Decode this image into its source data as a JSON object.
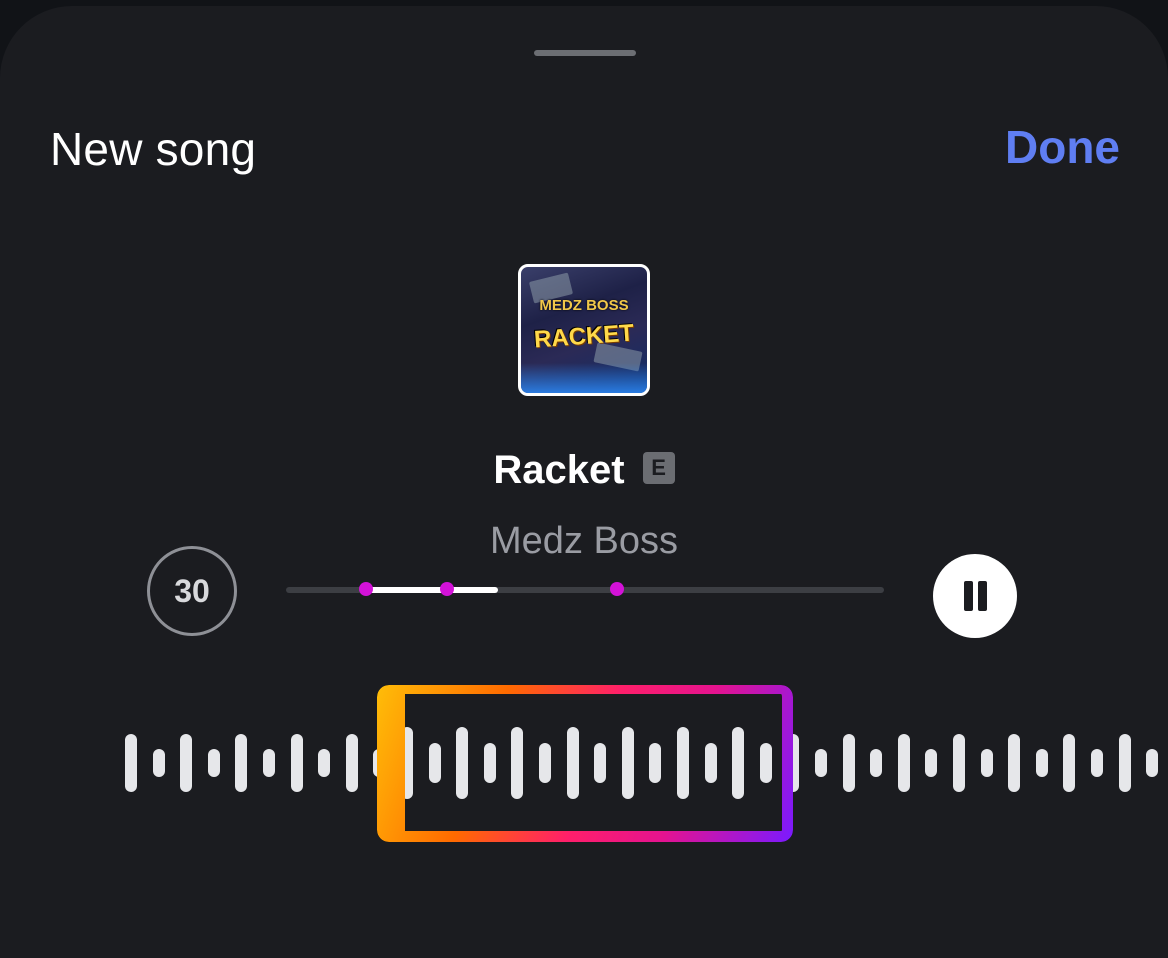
{
  "header": {
    "title": "New song",
    "done_label": "Done"
  },
  "cover": {
    "artist_logo": "MEDZ BOSS",
    "title_logo": "RACKET"
  },
  "track": {
    "title": "Racket",
    "explicit_badge": "E",
    "artist": "Medz Boss"
  },
  "player": {
    "clip_duration_label": "30",
    "progress_fraction": 0.22,
    "play_state": "playing",
    "pause_icon": "pause-icon"
  },
  "colors": {
    "accent": "#5f7ef2",
    "background": "#1b1c20",
    "marker": "#d312d8",
    "selection_gradient": [
      "#ffbd08",
      "#ff6a00",
      "#ff1f6a",
      "#e5138f",
      "#7a1aff"
    ]
  }
}
